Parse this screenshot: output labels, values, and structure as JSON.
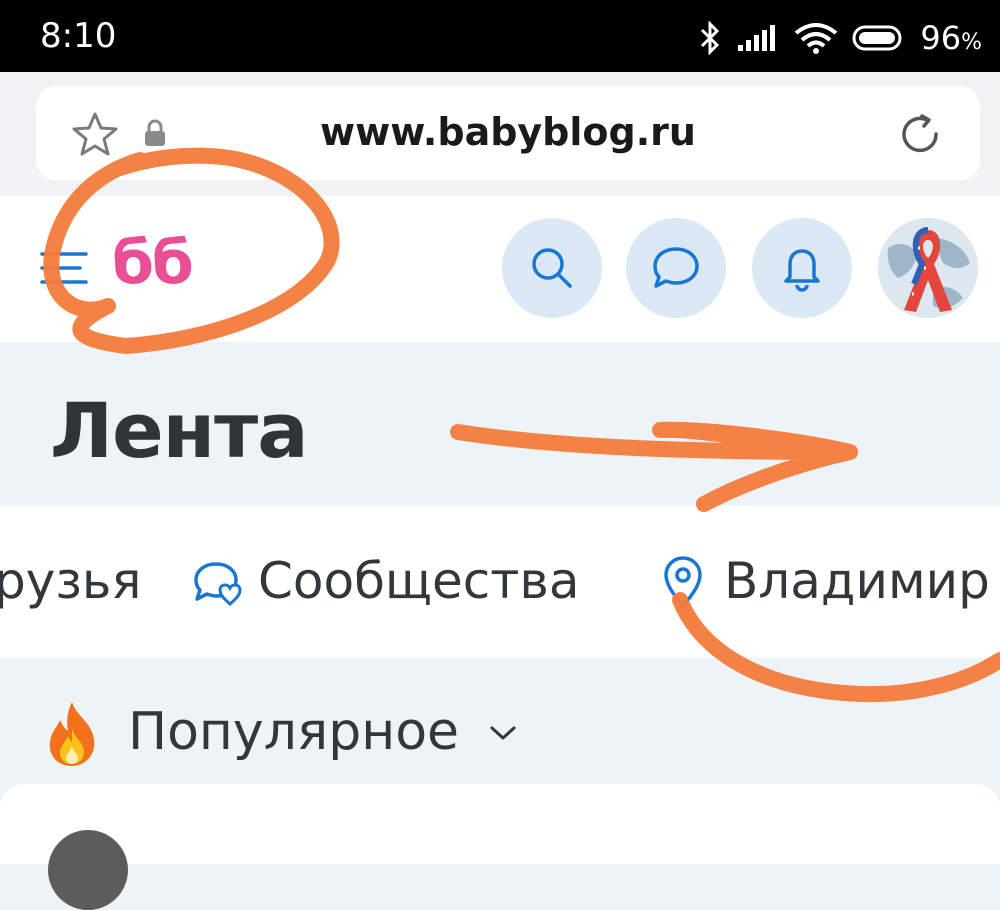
{
  "status_bar": {
    "time": "8:10",
    "battery_percent": "96",
    "battery_unit": "%"
  },
  "browser": {
    "url": "www.babyblog.ru"
  },
  "header": {
    "logo": "бб"
  },
  "page": {
    "title": "Лента"
  },
  "tabs": [
    {
      "label": "рузья"
    },
    {
      "label": "Сообщества",
      "icon": "community-icon"
    },
    {
      "label": "Владимир",
      "icon": "location-pin-icon"
    }
  ],
  "section": {
    "title": "Популярное",
    "icon": "fire-icon"
  },
  "colors": {
    "logo": "#ea4f96",
    "accent_blue": "#1877d2",
    "button_bg": "#dbe9f7",
    "annotation": "#f47b3b"
  }
}
